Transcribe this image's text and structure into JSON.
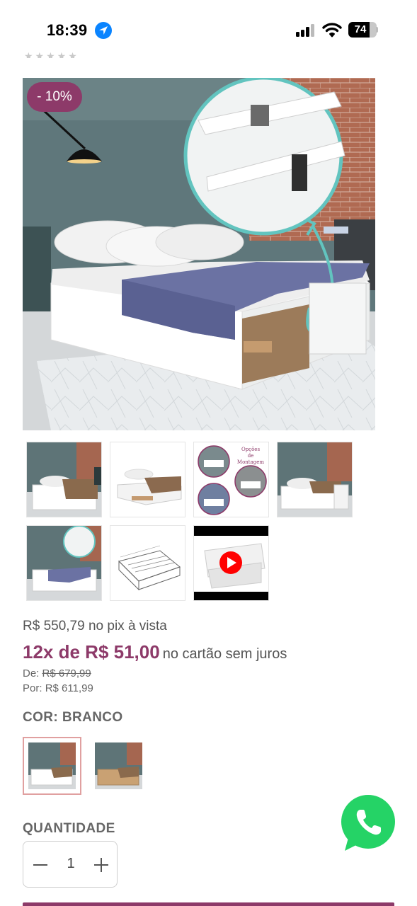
{
  "status_bar": {
    "time": "18:39",
    "battery": "74"
  },
  "product": {
    "discount_badge": "- 10%",
    "pix_price": "R$ 550,79 no pix à vista",
    "installments_main": "12x de R$ 51,00",
    "installments_sub": "no cartão sem juros",
    "from_label": "De:",
    "from_price": "R$ 679,99",
    "by_label": "Por:",
    "by_price": "R$ 611,99",
    "color_label": "COR: BRANCO",
    "quantity_label": "QUANTIDADE",
    "quantity_value": "1"
  },
  "thumbnails": [
    {
      "name": "bed-room-brown-blanket",
      "icon": "photo"
    },
    {
      "name": "bed-white-background",
      "icon": "photo"
    },
    {
      "name": "assembly-options",
      "icon": "photo",
      "caption": "Opções de Montagem"
    },
    {
      "name": "bed-footboard",
      "icon": "photo"
    },
    {
      "name": "bed-detail-zoom",
      "icon": "photo"
    },
    {
      "name": "technical-drawing",
      "icon": "photo"
    },
    {
      "name": "product-video",
      "icon": "play-icon"
    }
  ],
  "color_options": [
    {
      "name": "branco",
      "selected": true
    },
    {
      "name": "madeira",
      "selected": false
    }
  ],
  "colors": {
    "accent": "#8d3a69",
    "whatsapp": "#25d366",
    "status_blue": "#0a84ff"
  }
}
